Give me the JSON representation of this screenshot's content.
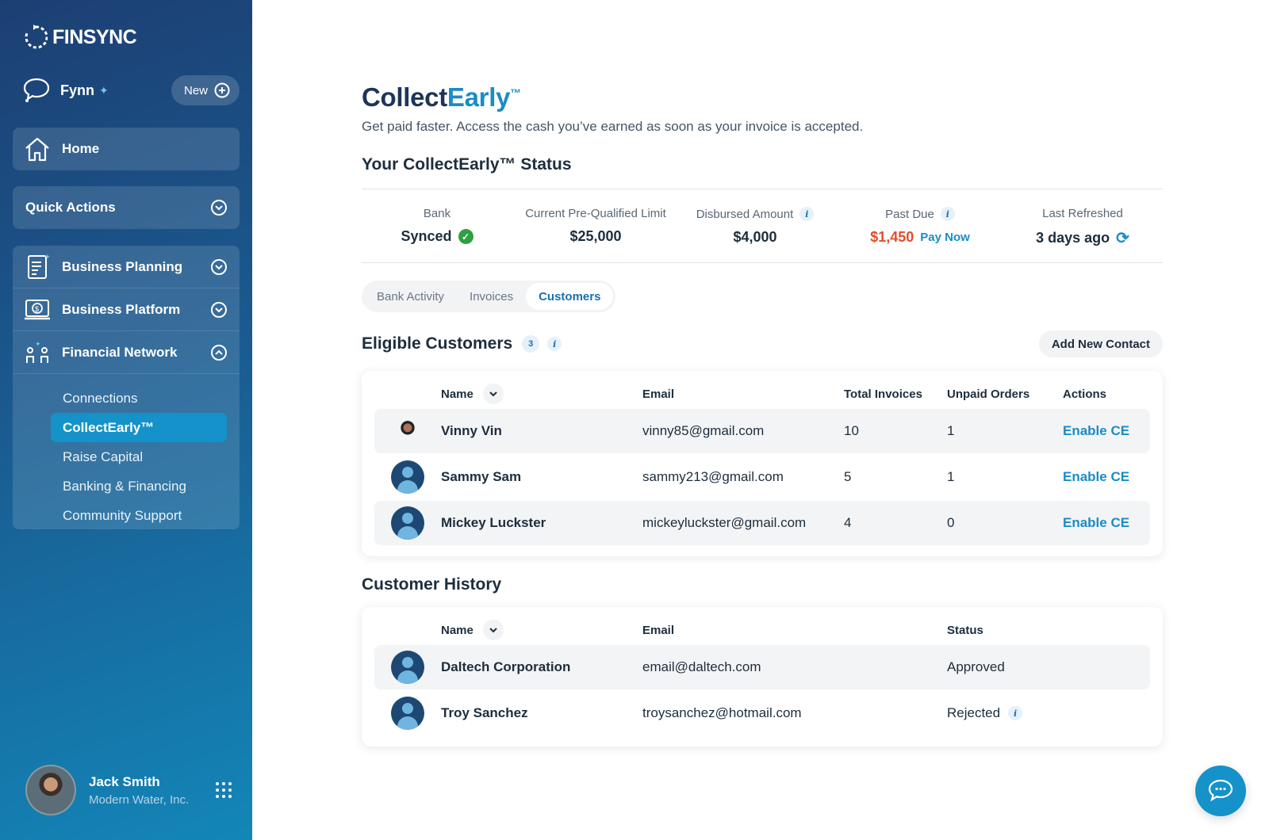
{
  "sidebar": {
    "logo_text": "FINSYNC",
    "fynn_label": "Fynn",
    "new_label": "New",
    "home_label": "Home",
    "quick_actions_label": "Quick Actions",
    "groups": [
      {
        "label": "Business Planning",
        "icon": "document-chart-icon"
      },
      {
        "label": "Business Platform",
        "icon": "dollar-laptop-icon"
      },
      {
        "label": "Financial Network",
        "icon": "network-people-icon"
      }
    ],
    "sub_items": [
      "Connections",
      "CollectEarly™",
      "Raise Capital",
      "Banking & Financing",
      "Community Support"
    ],
    "active_sub_item": "CollectEarly™",
    "user": {
      "name": "Jack Smith",
      "company": "Modern Water, Inc."
    }
  },
  "main": {
    "title_prefix": "Collect",
    "title_accent": "Early",
    "title_tm": "™",
    "subtitle": "Get paid faster. Access the cash you’ve earned as soon as your invoice is accepted.",
    "status_heading": "Your CollectEarly™ Status",
    "status": {
      "bank_label": "Bank",
      "bank_value": "Synced",
      "limit_label": "Current Pre-Qualified Limit",
      "limit_value": "$25,000",
      "disbursed_label": "Disbursed Amount",
      "disbursed_value": "$4,000",
      "past_due_label": "Past Due",
      "past_due_value": "$1,450",
      "pay_now_label": "Pay Now",
      "refreshed_label": "Last Refreshed",
      "refreshed_value": "3 days ago"
    },
    "tabs": [
      "Bank Activity",
      "Invoices",
      "Customers"
    ],
    "active_tab": "Customers",
    "eligible": {
      "title": "Eligible Customers",
      "count": "3",
      "add_button": "Add New Contact",
      "columns": [
        "Name",
        "Email",
        "Total Invoices",
        "Unpaid Orders",
        "Actions"
      ],
      "rows": [
        {
          "name": "Vinny Vin",
          "email": "vinny85@gmail.com",
          "total": "10",
          "unpaid": "1",
          "action": "Enable CE"
        },
        {
          "name": "Sammy Sam",
          "email": "sammy213@gmail.com",
          "total": "5",
          "unpaid": "1",
          "action": "Enable CE"
        },
        {
          "name": "Mickey Luckster",
          "email": "mickeyluckster@gmail.com",
          "total": "4",
          "unpaid": "0",
          "action": "Enable CE"
        }
      ]
    },
    "history": {
      "title": "Customer History",
      "columns": [
        "Name",
        "Email",
        "Status"
      ],
      "rows": [
        {
          "name": "Daltech Corporation",
          "email": "email@daltech.com",
          "status": "Approved"
        },
        {
          "name": "Troy Sanchez",
          "email": "troysanchez@hotmail.com",
          "status": "Rejected"
        }
      ]
    }
  },
  "colors": {
    "accent": "#1b8cc7",
    "past_due": "#e04f2c",
    "synced": "#2ea043"
  }
}
